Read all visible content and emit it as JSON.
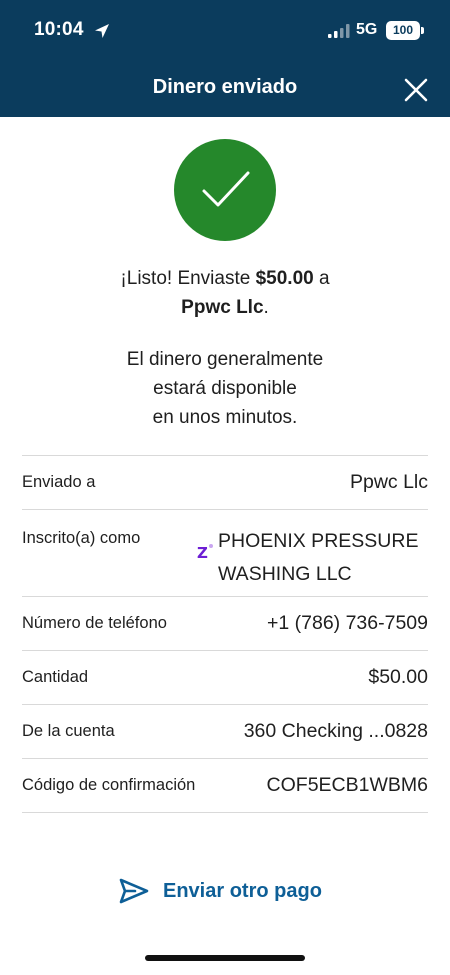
{
  "status_bar": {
    "time": "10:04",
    "network": "5G",
    "battery": "100"
  },
  "header": {
    "title": "Dinero enviado"
  },
  "confirmation": {
    "msg_prefix": "¡Listo! Enviaste ",
    "amount": "$50.00",
    "msg_mid": " a",
    "recipient": "Ppwc Llc",
    "recipient_suffix": ".",
    "availability_line1": "El dinero generalmente",
    "availability_line2": "estará disponible",
    "availability_line3": "en unos minutos."
  },
  "details": [
    {
      "label": "Enviado a",
      "value": "Ppwc Llc"
    },
    {
      "label": "Inscrito(a) como",
      "value_line1": "PHOENIX PRESSURE",
      "value_line2": "WASHING LLC"
    },
    {
      "label": "Número de teléfono",
      "value": "+1 (786) 736-7509"
    },
    {
      "label": "Cantidad",
      "value": "$50.00"
    },
    {
      "label": "De la cuenta",
      "value": "360 Checking ...0828"
    },
    {
      "label": "Código de confirmación",
      "value": "COF5ECB1WBM6"
    }
  ],
  "actions": {
    "send_again": "Enviar otro pago"
  },
  "colors": {
    "header_bg": "#0b3c5d",
    "success_green": "#25882b",
    "link_blue": "#0e5f97",
    "zelle_purple": "#6d1ed4"
  },
  "icons": {
    "location": "location-arrow-icon",
    "signal": "signal-bars-icon",
    "close": "close-icon",
    "check": "checkmark-icon",
    "zelle": "zelle-icon",
    "send": "paper-plane-icon"
  }
}
